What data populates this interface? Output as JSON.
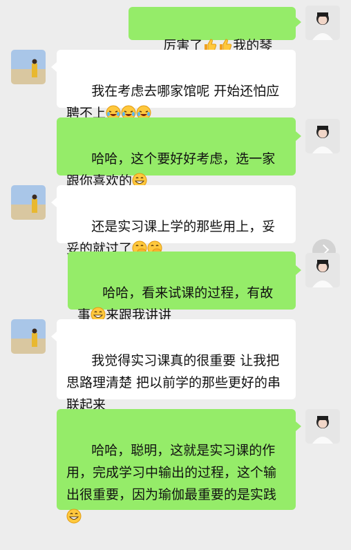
{
  "conversation": {
    "messages": [
      {
        "side": "me",
        "text": "厉害了",
        "emojis_after": [
          "thumbs-up-icon"
        ],
        "text2": "我的琴",
        "emojis_end": [
          "thumbs-up-icon"
        ]
      },
      {
        "side": "them",
        "text": "我在考虑去哪家馆呢 开始还怕应聘不上",
        "emojis_end": [
          "laughing-crying-icon",
          "laughing-crying-icon",
          "laughing-crying-icon"
        ]
      },
      {
        "side": "me",
        "text": "哈哈，这个要好好考虑，选一家跟你喜欢的",
        "emojis_end": [
          "grin-icon"
        ]
      },
      {
        "side": "them",
        "text": "还是实习课上学的那些用上，妥妥的就过了",
        "emojis_end": [
          "hand-over-mouth-icon",
          "hand-over-mouth-icon"
        ]
      },
      {
        "side": "me",
        "text": "哈哈，看来试课的过程，有故事",
        "emojis_mid": [
          "grin-icon"
        ],
        "text2": "来跟我讲讲"
      },
      {
        "side": "them",
        "text": "我觉得实习课真的很重要 让我把思路理清楚 把以前学的那些更好的串联起来"
      },
      {
        "side": "me",
        "text": "哈哈，聪明，这就是实习课的作用，完成学习中输出的过程，这个输出很重要，因为瑜伽最重要的是实践",
        "emojis_end": [
          "grin-icon"
        ]
      }
    ]
  },
  "ui": {
    "me_bubble_color": "#95ec69",
    "them_bubble_color": "#ffffff",
    "background": "#ededed",
    "scroll_button_icon": "chevron-right-icon"
  }
}
